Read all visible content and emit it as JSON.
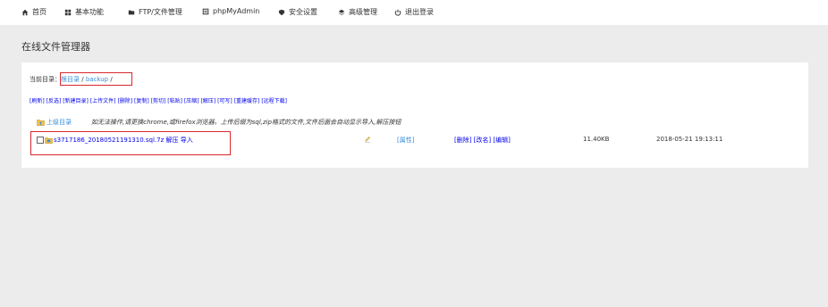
{
  "nav": [
    {
      "label": "首页",
      "icon": "home-icon"
    },
    {
      "label": "基本功能",
      "icon": "grid-icon"
    },
    {
      "label": "FTP/文件管理",
      "icon": "folder-icon"
    },
    {
      "label": "phpMyAdmin",
      "icon": "database-icon"
    },
    {
      "label": "安全设置",
      "icon": "shield-icon"
    },
    {
      "label": "高级管理",
      "icon": "layers-icon"
    },
    {
      "label": "退出登录",
      "icon": "power-icon"
    }
  ],
  "page_title": "在线文件管理器",
  "current_dir": {
    "label": "当前目录：",
    "root": "根目录",
    "sep1": " / ",
    "folder": "backup",
    "sep2": " /"
  },
  "actions": [
    "[刷新]",
    "[反选]",
    "[新建目录]",
    "[上传文件]",
    "[删除]",
    "[复制]",
    "[剪切]",
    "[粘贴]",
    "[压缩]",
    "[解压]",
    "[可写]",
    "[重建缓存]",
    "[远程下载]"
  ],
  "parent": {
    "link": "上级目录",
    "hint": "如无法操作,请更换chrome,或firefox浏览器。上传后缀为sql,zip格式的文件,文件后面会自动显示导入,解压按钮"
  },
  "file": {
    "name": "s3717186_20180521191310.sql.7z",
    "extra1": "解压",
    "extra2": "导入",
    "attr": "[属性]",
    "ops": [
      "[删除]",
      "[改名]",
      "[编辑]"
    ],
    "size": "11.40KB",
    "mtime": "2018-05-21 19:13:11"
  }
}
